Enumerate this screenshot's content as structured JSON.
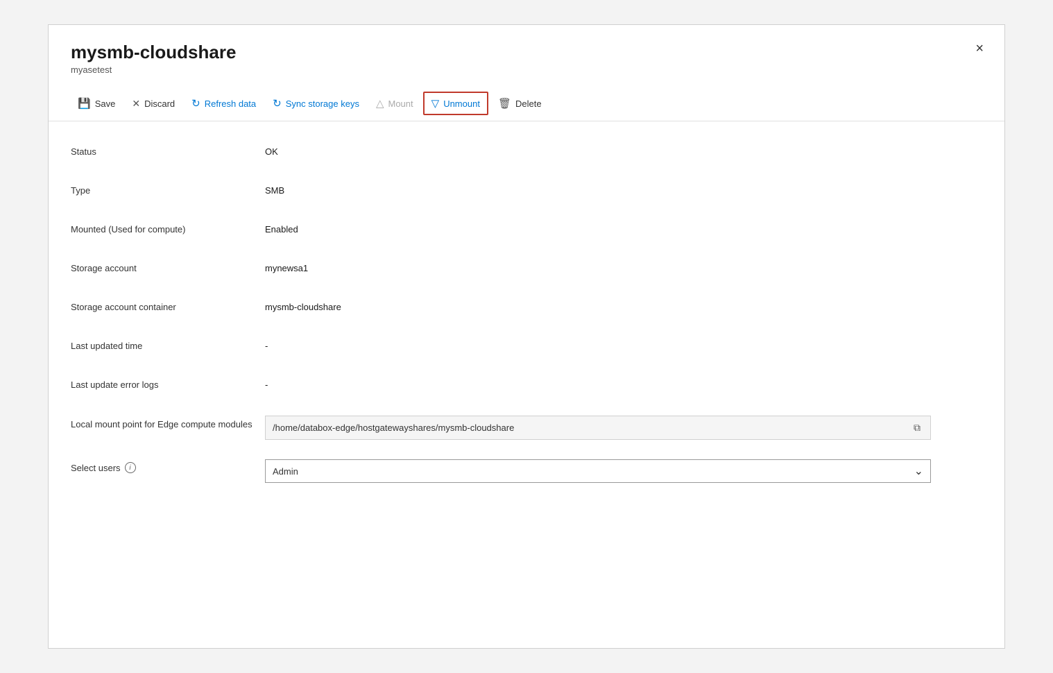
{
  "panel": {
    "title": "mysmb-cloudshare",
    "subtitle": "myasetest"
  },
  "toolbar": {
    "buttons": [
      {
        "id": "save",
        "label": "Save",
        "icon": "💾",
        "highlight": false,
        "blue": false
      },
      {
        "id": "discard",
        "label": "Discard",
        "icon": "✕",
        "highlight": false,
        "blue": false
      },
      {
        "id": "refresh",
        "label": "Refresh data",
        "icon": "↻",
        "highlight": false,
        "blue": true
      },
      {
        "id": "sync",
        "label": "Sync storage keys",
        "icon": "↻",
        "highlight": false,
        "blue": true
      },
      {
        "id": "mount",
        "label": "Mount",
        "icon": "△",
        "highlight": false,
        "blue": false
      },
      {
        "id": "unmount",
        "label": "Unmount",
        "icon": "▽",
        "highlight": true,
        "blue": true
      },
      {
        "id": "delete",
        "label": "Delete",
        "icon": "🗑",
        "highlight": false,
        "blue": false
      }
    ]
  },
  "fields": [
    {
      "id": "status",
      "label": "Status",
      "value": "OK",
      "type": "text"
    },
    {
      "id": "type",
      "label": "Type",
      "value": "SMB",
      "type": "text"
    },
    {
      "id": "mounted",
      "label": "Mounted (Used for compute)",
      "value": "Enabled",
      "type": "text"
    },
    {
      "id": "storage-account",
      "label": "Storage account",
      "value": "mynewsa1",
      "type": "text"
    },
    {
      "id": "storage-container",
      "label": "Storage account container",
      "value": "mysmb-cloudshare",
      "type": "text"
    },
    {
      "id": "last-updated",
      "label": "Last updated time",
      "value": "-",
      "type": "text"
    },
    {
      "id": "error-logs",
      "label": "Last update error logs",
      "value": "-",
      "type": "text"
    },
    {
      "id": "mount-point",
      "label": "Local mount point for Edge compute modules",
      "value": "/home/databox-edge/hostgatewayshares/mysmb-cloudshare",
      "type": "readonly-input"
    },
    {
      "id": "select-users",
      "label": "Select users",
      "value": "Admin",
      "type": "dropdown",
      "has-info": true
    }
  ],
  "close_label": "×",
  "copy_icon": "⧉",
  "dropdown_arrow": "⌄",
  "info_icon": "i"
}
